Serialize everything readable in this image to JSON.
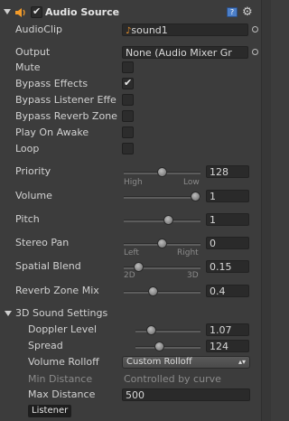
{
  "component": {
    "title": "Audio Source",
    "enabled": true,
    "help_icon": "help-book-icon",
    "settings_icon": "gear-icon",
    "component_icon": "speaker-icon"
  },
  "properties": {
    "audioclip": {
      "label": "AudioClip",
      "value": "sound1"
    },
    "output": {
      "label": "Output",
      "value": "None (Audio Mixer Gr"
    },
    "mute": {
      "label": "Mute",
      "checked": false
    },
    "bypass_effects": {
      "label": "Bypass Effects",
      "checked": true
    },
    "bypass_listener": {
      "label": "Bypass Listener Effe",
      "checked": false
    },
    "bypass_reverb": {
      "label": "Bypass Reverb Zone",
      "checked": false
    },
    "play_on_awake": {
      "label": "Play On Awake",
      "checked": false
    },
    "loop": {
      "label": "Loop",
      "checked": false
    },
    "priority": {
      "label": "Priority",
      "value": "128",
      "low_label": "High",
      "high_label": "Low",
      "fraction": 0.5
    },
    "volume": {
      "label": "Volume",
      "value": "1",
      "fraction": 1.0
    },
    "pitch": {
      "label": "Pitch",
      "value": "1",
      "fraction": 0.6
    },
    "stereo_pan": {
      "label": "Stereo Pan",
      "value": "0",
      "low_label": "Left",
      "high_label": "Right",
      "fraction": 0.5
    },
    "spatial_blend": {
      "label": "Spatial Blend",
      "value": "0.15",
      "low_label": "2D",
      "high_label": "3D",
      "fraction": 0.15
    },
    "reverb_zone_mix": {
      "label": "Reverb Zone Mix",
      "value": "0.4",
      "fraction": 0.36
    }
  },
  "sound3d": {
    "title": "3D Sound Settings",
    "doppler": {
      "label": "Doppler Level",
      "value": "1.07",
      "fraction": 0.2
    },
    "spread": {
      "label": "Spread",
      "value": "124",
      "fraction": 0.34
    },
    "rolloff": {
      "label": "Volume Rolloff",
      "value": "Custom Rolloff"
    },
    "min_distance": {
      "label": "Min Distance",
      "value": "Controlled by curve"
    },
    "max_distance": {
      "label": "Max Distance",
      "value": "500"
    }
  },
  "tooltip": {
    "label": "Listener"
  },
  "colors": {
    "accent_speaker": "#f29b2a",
    "clip_icon": "#e8902a",
    "background": "#3c3c3c"
  }
}
